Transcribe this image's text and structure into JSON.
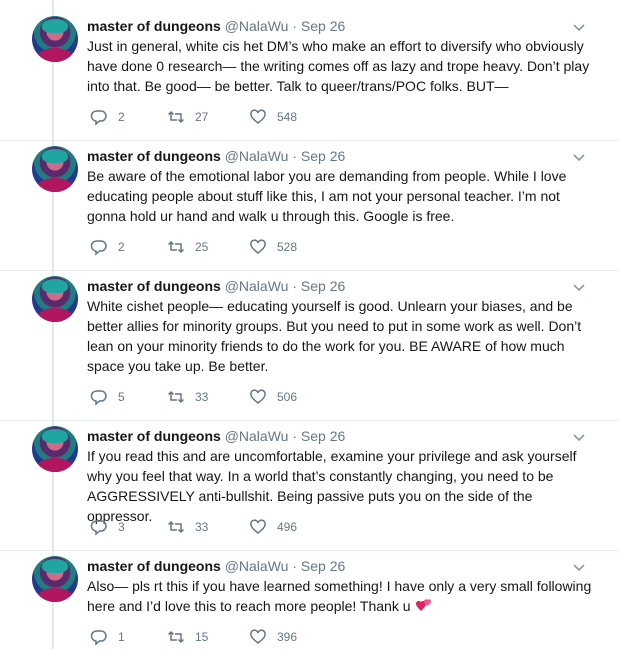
{
  "author": {
    "name": "master of dungeons",
    "handle": "@NalaWu",
    "separator": "·"
  },
  "tweets": [
    {
      "date": "Sep 26",
      "text": "Just in general, white cis het DM’s who make an effort to diversify who obviously have done 0 research— the writing comes off as lazy and trope heavy. Don’t play into that. Be good— be better. Talk to queer/trans/POC folks. BUT—",
      "replies": "2",
      "retweets": "27",
      "likes": "548"
    },
    {
      "date": "Sep 26",
      "text": "Be aware of the emotional labor you are demanding from people. While I love educating people about stuff like this, I am not your personal teacher. I’m not gonna hold ur hand and walk u through this. Google is free.",
      "replies": "2",
      "retweets": "25",
      "likes": "528"
    },
    {
      "date": "Sep 26",
      "text": "White cishet people— educating yourself is good. Unlearn your biases, and be better allies for minority groups. But you need to put in some work as well. Don’t lean on your minority friends to do the work for you. BE AWARE of how much space you take up. Be better.",
      "replies": "5",
      "retweets": "33",
      "likes": "506"
    },
    {
      "date": "Sep 26",
      "text": "If you read this and are uncomfortable, examine your privilege and ask yourself why you feel that way. In a world that’s constantly changing, you need to be AGGRESSIVELY anti-bullshit. Being passive puts you on the side of the oppressor.",
      "replies": "3",
      "retweets": "33",
      "likes": "496"
    },
    {
      "date": "Sep 26",
      "text": "Also— pls rt this if you have learned something! I have only a very small following here and I’d love this to reach more people! Thank u",
      "emoji": "💕",
      "replies": "1",
      "retweets": "15",
      "likes": "396"
    }
  ],
  "icons": {
    "reply": "reply-icon",
    "retweet": "retweet-icon",
    "like": "heart-icon",
    "menu": "chevron-down-icon"
  },
  "colors": {
    "text": "#14171a",
    "secondary": "#657786",
    "thread_line": "#e1e8ed",
    "emoji_heart": "#e0245e"
  }
}
